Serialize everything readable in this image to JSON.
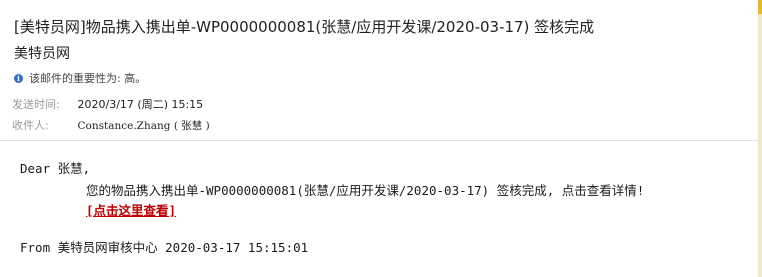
{
  "email": {
    "subject": "[美特员网]物品携入携出单-WP0000000081(张慧/应用开发课/2020-03-17) 签核完成",
    "sender": "美特员网",
    "importance_text": "该邮件的重要性为: 高。",
    "sent_label": "发送时间:",
    "sent_value": "2020/3/17 (周二) 15:15",
    "to_label": "收件人:",
    "to_value": "Constance.Zhang ( 张慧 )"
  },
  "body": {
    "greeting": "Dear 张慧,",
    "message": "您的物品携入携出单-WP0000000081(张慧/应用开发课/2020-03-17) 签核完成, 点击查看详情!",
    "link_text": "[点击这里查看]",
    "signature": "From 美特员网审核中心 2020-03-17 15:15:01"
  },
  "colors": {
    "link": "#c00000",
    "info_icon": "#2f6fd1",
    "label_gray": "#9a9a9a"
  },
  "icons": {
    "importance": "info-icon"
  }
}
